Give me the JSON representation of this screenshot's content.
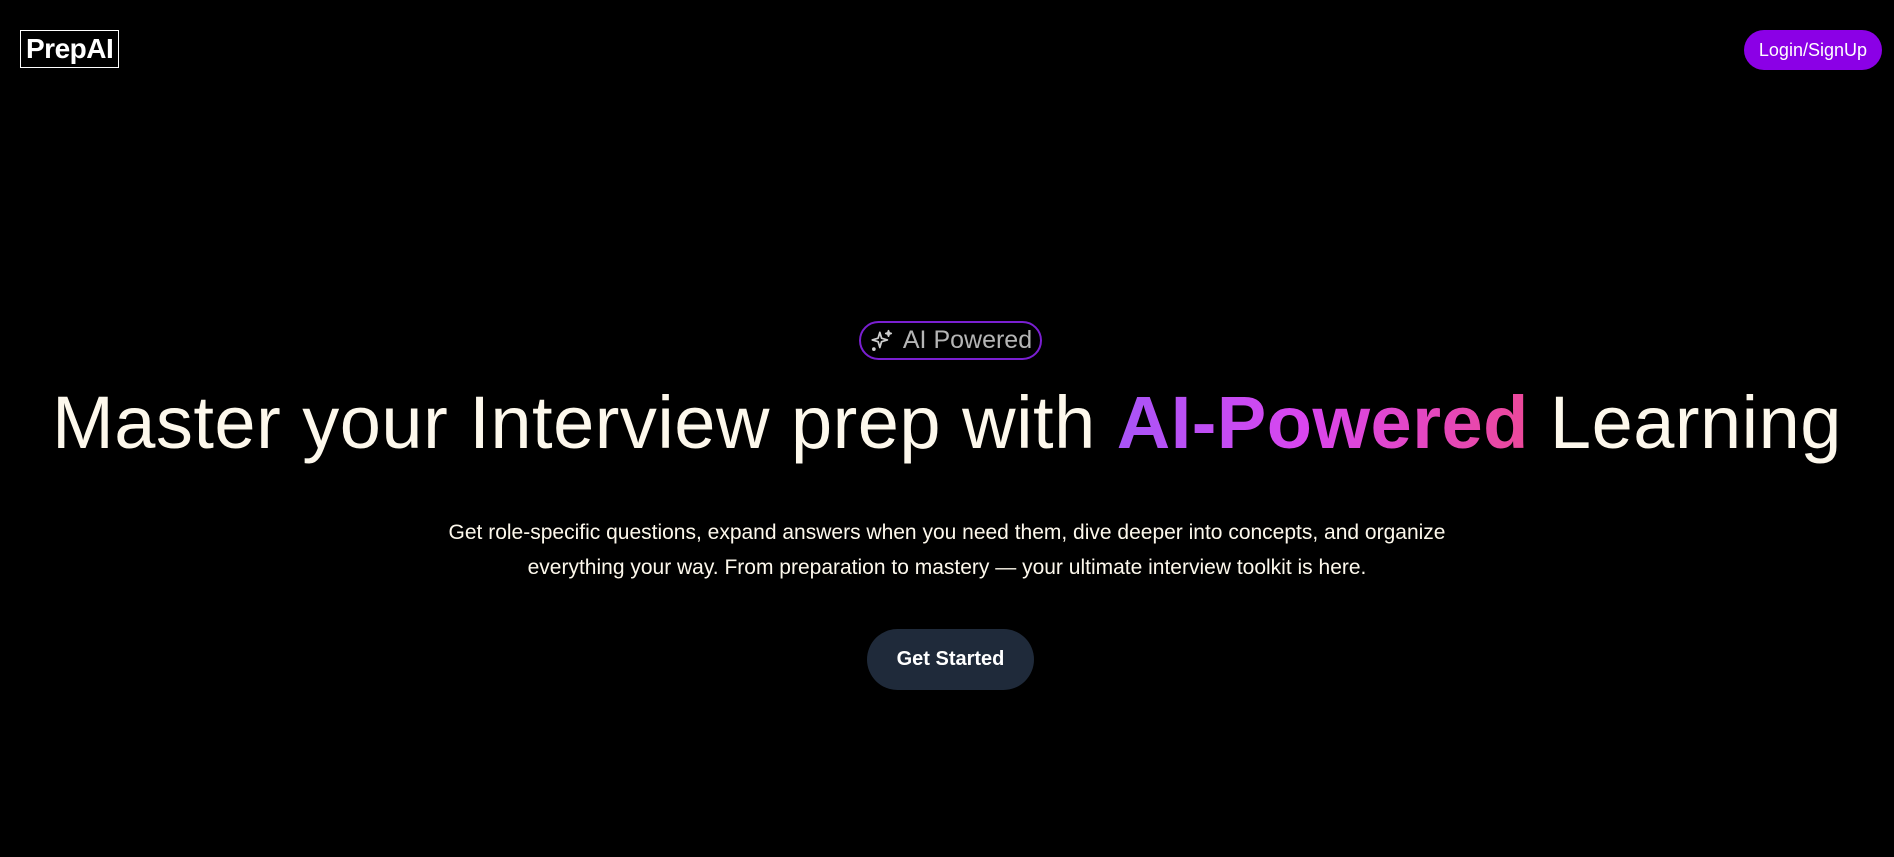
{
  "header": {
    "logo_text": "PrepAI",
    "login_label": "Login/SignUp"
  },
  "hero": {
    "badge": {
      "icon": "sparkles-icon",
      "label": "AI Powered"
    },
    "headline": {
      "before": "Master your Interview prep with ",
      "highlight": "AI-Powered",
      "after": " Learning"
    },
    "subtext_line1": "Get role-specific questions, expand answers when you need them, dive deeper into concepts, and organize",
    "subtext_line2": "everything your way. From preparation to mastery — your ultimate interview toolkit is here.",
    "cta_label": "Get Started"
  },
  "colors": {
    "background": "#000000",
    "accent_purple": "#8b00e6",
    "gradient_start": "#a855f7",
    "gradient_end": "#ec4899",
    "cta_background": "#1f2a3a",
    "text": "#fdf8ec"
  }
}
